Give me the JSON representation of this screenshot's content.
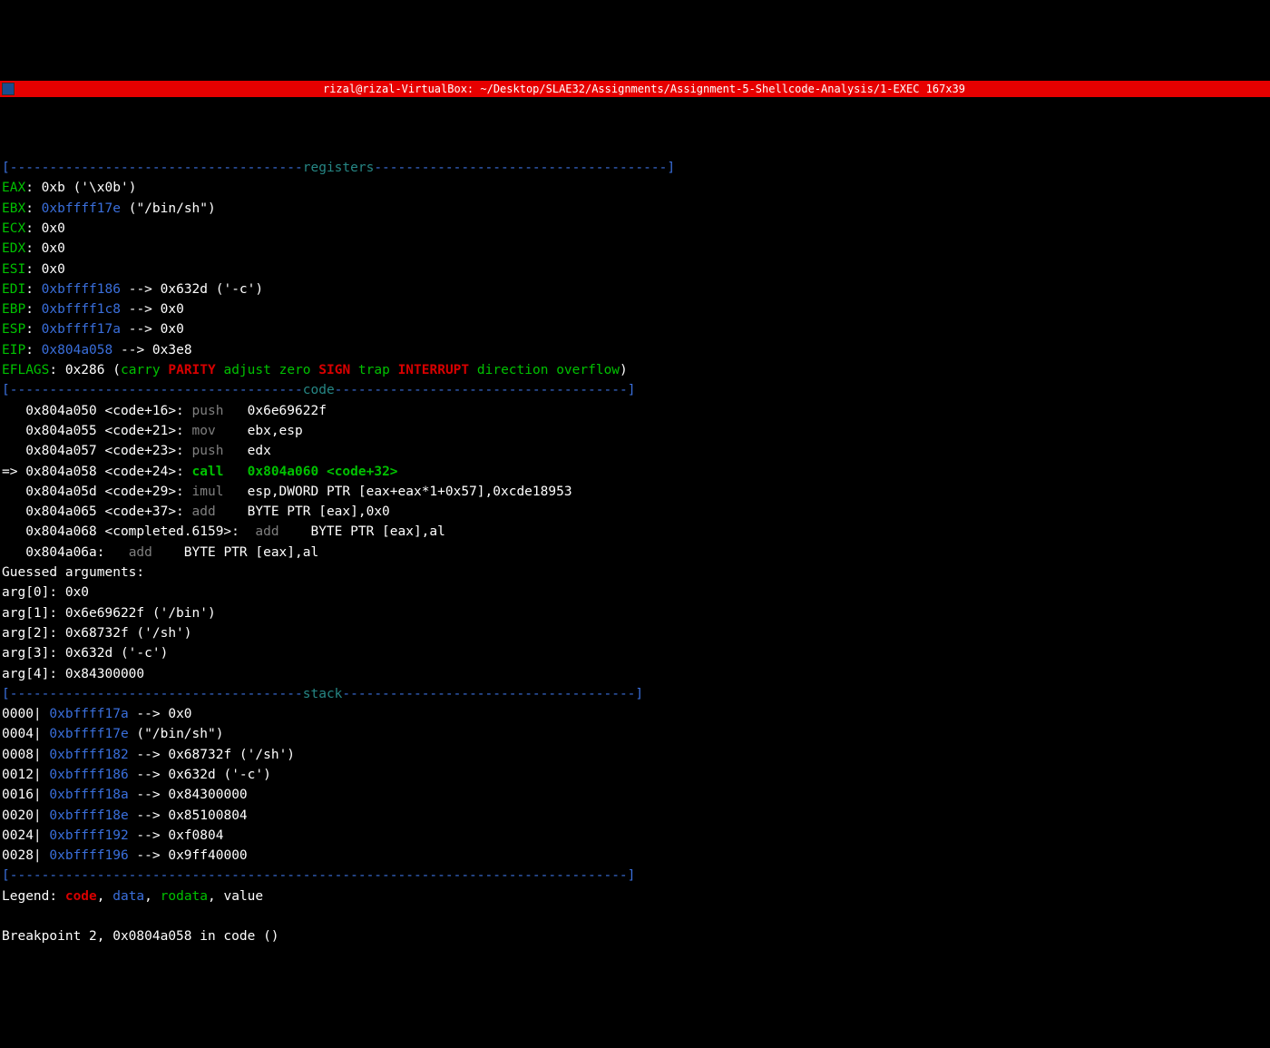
{
  "titlebar": "rizal@rizal-VirtualBox: ~/Desktop/SLAE32/Assignments/Assignment-5-Shellcode-Analysis/1-EXEC 167x39",
  "section": {
    "registers": "registers",
    "code": "code",
    "stack": "stack"
  },
  "reg": {
    "eax_l": "EAX",
    "eax_v": ": 0xb ('\\x0b')",
    "ebx_l": "EBX",
    "ebx_a": "0xbffff17e",
    "ebx_s": " (\"/bin/sh\")",
    "ecx_l": "ECX",
    "ecx_v": ": 0x0",
    "edx_l": "EDX",
    "edx_v": ": 0x0",
    "esi_l": "ESI",
    "esi_v": ": 0x0",
    "edi_l": "EDI",
    "edi_a": "0xbffff186",
    "edi_v": " --> 0x632d ('-c')",
    "ebp_l": "EBP",
    "ebp_a": "0xbffff1c8",
    "ebp_v": " --> 0x0",
    "esp_l": "ESP",
    "esp_a": "0xbffff17a",
    "esp_v": " --> 0x0",
    "eip_l": "EIP",
    "eip_a": "0x804a058",
    "eip_v": " --> 0x3e8",
    "eflags_l": "EFLAGS",
    "eflags_v": ": 0x286 (",
    "carry": "carry",
    "parity": "PARITY",
    "adjust": "adjust",
    "zero": "zero",
    "sign": "SIGN",
    "trap": "trap",
    "interrupt": "INTERRUPT",
    "direction": "direction",
    "overflow": "overflow"
  },
  "code": {
    "l1a": "   0x804a050 <code+16>:",
    "l1m": " push   ",
    "l1o": "0x6e69622f",
    "l2a": "   0x804a055 <code+21>:",
    "l2m": " mov    ",
    "l2o": "ebx,esp",
    "l3a": "   0x804a057 <code+23>:",
    "l3m": " push   ",
    "l3o": "edx",
    "arrow": "=> ",
    "l4a": "0x804a058 <code+24>:",
    "l4m": " call   ",
    "l4t": "0x804a060",
    "l4s": " <code+32>",
    "l5a": "   0x804a05d <code+29>:",
    "l5m": " imul   ",
    "l5o": "esp,DWORD PTR [eax+eax*1+0x57],0xcde18953",
    "l6a": "   0x804a065 <code+37>:",
    "l6m": " add    ",
    "l6o": "BYTE PTR [eax],0x0",
    "l7a": "   0x804a068 <completed.6159>:  ",
    "l7m": "add    ",
    "l7o": "BYTE PTR [eax],al",
    "l8a": "   0x804a06a:   ",
    "l8m": "add    ",
    "l8o": "BYTE PTR [eax],al"
  },
  "args": {
    "title": "Guessed arguments:",
    "a0": "arg[0]: 0x0",
    "a1": "arg[1]: 0x6e69622f ('/bin')",
    "a2": "arg[2]: 0x68732f ('/sh')",
    "a3": "arg[3]: 0x632d ('-c')",
    "a4": "arg[4]: 0x84300000"
  },
  "stack": {
    "s0o": "0000| ",
    "s0a": "0xbffff17a",
    "s0v": " --> 0x0",
    "s1o": "0004| ",
    "s1a": "0xbffff17e",
    "s1v": " (\"/bin/sh\")",
    "s2o": "0008| ",
    "s2a": "0xbffff182",
    "s2v": " --> 0x68732f ('/sh')",
    "s3o": "0012| ",
    "s3a": "0xbffff186",
    "s3v": " --> 0x632d ('-c')",
    "s4o": "0016| ",
    "s4a": "0xbffff18a",
    "s4v": " --> 0x84300000",
    "s5o": "0020| ",
    "s5a": "0xbffff18e",
    "s5v": " --> 0x85100804",
    "s6o": "0024| ",
    "s6a": "0xbffff192",
    "s6v": " --> 0xf0804",
    "s7o": "0028| ",
    "s7a": "0xbffff196",
    "s7v": " --> 0x9ff40000"
  },
  "legend": {
    "label": "Legend: ",
    "code": "code",
    "data": "data",
    "rodata": "rodata",
    "value": "value"
  },
  "breakpoint": "Breakpoint 2, 0x0804a058 in code ()",
  "dashes": {
    "lbr": "[",
    "rbr": "]",
    "reg_left": "-------------------------------------",
    "reg_right": "-------------------------------------",
    "code_left": "-------------------------------------",
    "code_right": "-------------------------------------",
    "stack_left": "-------------------------------------",
    "stack_right": "-------------------------------------",
    "end": "------------------------------------------------------------------------------"
  }
}
